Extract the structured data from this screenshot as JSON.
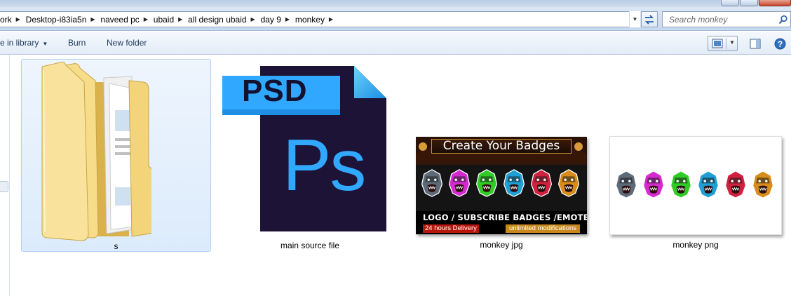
{
  "address_bar": {
    "crumbs": [
      "ork",
      "Desktop-i83ia5n",
      "naveed pc",
      "ubaid",
      "all design ubaid",
      "day 9",
      "monkey"
    ]
  },
  "search": {
    "placeholder": "Search monkey"
  },
  "toolbar": {
    "include_label": "e in library",
    "burn_label": "Burn",
    "new_folder_label": "New folder"
  },
  "files": [
    {
      "name": "s",
      "kind": "folder",
      "selected": true
    },
    {
      "name": "main source file",
      "kind": "psd",
      "badge": "PSD",
      "app_mark": "Ps"
    },
    {
      "name": "monkey jpg",
      "kind": "image-jpg"
    },
    {
      "name": "monkey png",
      "kind": "image-png"
    }
  ],
  "banner": {
    "title": "Create Your Badges",
    "subtitle": "LOGO / SUBSCRIBE BADGES /EMOTES",
    "delivery": "24 hours Delivery",
    "modifications": "unlimited modifications"
  },
  "gorilla_colors": [
    "#5d6a78",
    "#d52ad0",
    "#2fcc25",
    "#1f9fd4",
    "#d0213e",
    "#d88c1a"
  ],
  "colors": {
    "selection_bg": "#dcebfc",
    "psd_dark": "#1d1337",
    "psd_accent": "#31a8ff",
    "folder": "#f4d57a"
  }
}
